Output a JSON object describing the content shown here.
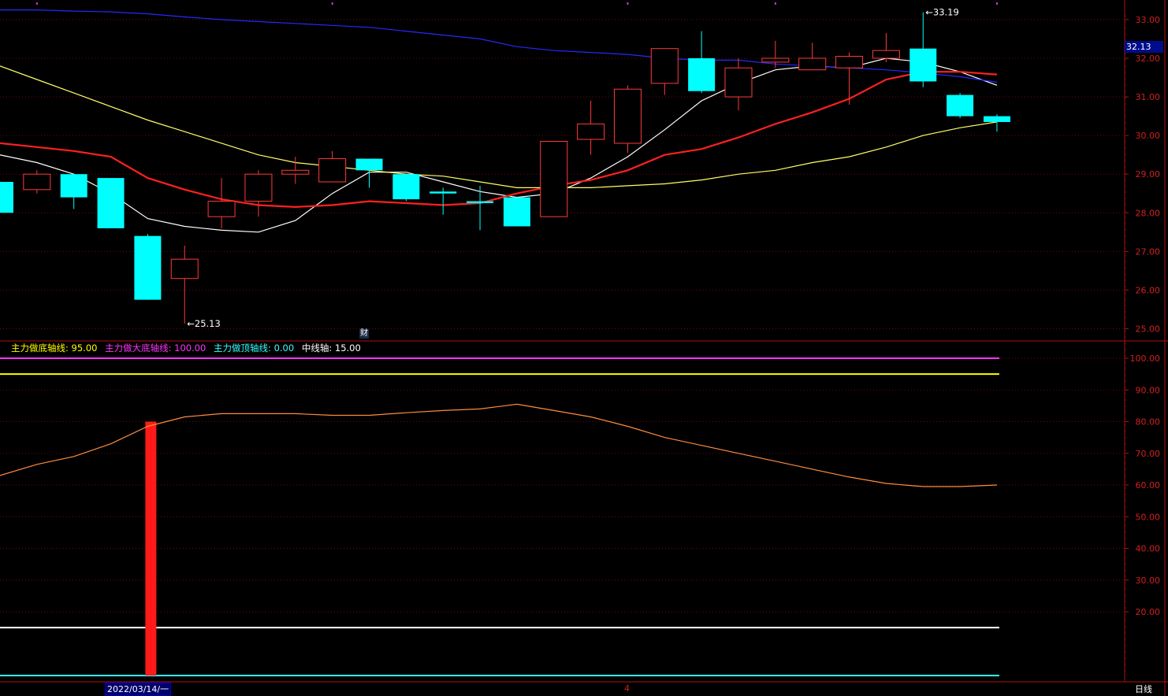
{
  "chart_data": [
    {
      "type": "candlestick",
      "title": "",
      "ylim": [
        24.7,
        33.45
      ],
      "y_ticks": [
        "25.00",
        "26.00",
        "27.00",
        "28.00",
        "29.00",
        "30.00",
        "31.00",
        "32.00",
        "33.00"
      ],
      "last_price_label": "32.13",
      "last_price": 32.13,
      "candles": [
        {
          "o": 28.8,
          "h": 28.8,
          "l": 28.0,
          "c": 28.0
        },
        {
          "o": 28.6,
          "h": 29.1,
          "l": 28.5,
          "c": 29.0
        },
        {
          "o": 29.0,
          "h": 29.0,
          "l": 28.1,
          "c": 28.4
        },
        {
          "o": 28.9,
          "h": 28.9,
          "l": 27.6,
          "c": 27.6
        },
        {
          "o": 27.4,
          "h": 27.45,
          "l": 25.75,
          "c": 25.75
        },
        {
          "o": 26.3,
          "h": 27.15,
          "l": 25.13,
          "c": 26.8
        },
        {
          "o": 27.9,
          "h": 28.9,
          "l": 27.6,
          "c": 28.3
        },
        {
          "o": 28.3,
          "h": 29.1,
          "l": 27.9,
          "c": 29.0
        },
        {
          "o": 29.0,
          "h": 29.45,
          "l": 28.75,
          "c": 29.1
        },
        {
          "o": 28.8,
          "h": 29.6,
          "l": 28.8,
          "c": 29.4
        },
        {
          "o": 29.4,
          "h": 29.4,
          "l": 28.65,
          "c": 29.1
        },
        {
          "o": 29.0,
          "h": 29.0,
          "l": 28.3,
          "c": 28.35
        },
        {
          "o": 28.55,
          "h": 28.65,
          "l": 27.95,
          "c": 28.5
        },
        {
          "o": 28.3,
          "h": 28.7,
          "l": 27.55,
          "c": 28.25
        },
        {
          "o": 28.4,
          "h": 28.4,
          "l": 27.65,
          "c": 27.65
        },
        {
          "o": 27.9,
          "h": 29.85,
          "l": 27.9,
          "c": 29.85
        },
        {
          "o": 29.9,
          "h": 30.9,
          "l": 29.5,
          "c": 30.3
        },
        {
          "o": 29.8,
          "h": 31.3,
          "l": 29.55,
          "c": 31.2
        },
        {
          "o": 31.35,
          "h": 32.25,
          "l": 31.05,
          "c": 32.25
        },
        {
          "o": 32.0,
          "h": 32.7,
          "l": 31.1,
          "c": 31.15
        },
        {
          "o": 31.0,
          "h": 32.0,
          "l": 30.65,
          "c": 31.75
        },
        {
          "o": 31.9,
          "h": 32.45,
          "l": 31.75,
          "c": 32.0
        },
        {
          "o": 31.7,
          "h": 32.4,
          "l": 31.7,
          "c": 32.0
        },
        {
          "o": 31.75,
          "h": 32.15,
          "l": 30.8,
          "c": 32.05
        },
        {
          "o": 32.0,
          "h": 32.65,
          "l": 31.9,
          "c": 32.2
        },
        {
          "o": 32.25,
          "h": 33.19,
          "l": 31.25,
          "c": 31.4
        },
        {
          "o": 31.05,
          "h": 31.1,
          "l": 30.45,
          "c": 30.5
        },
        {
          "o": 30.5,
          "h": 30.55,
          "l": 30.1,
          "c": 30.35
        }
      ],
      "ma_lines": [
        {
          "color": "#ffffff",
          "values": [
            29.5,
            29.3,
            29.0,
            28.5,
            27.85,
            27.65,
            27.55,
            27.5,
            27.8,
            28.5,
            29.05,
            29.05,
            28.8,
            28.55,
            28.4,
            28.5,
            28.9,
            29.45,
            30.15,
            30.9,
            31.35,
            31.7,
            31.8,
            31.75,
            32.0,
            31.9,
            31.65,
            31.3
          ]
        },
        {
          "color": "#ff2020",
          "values": [
            29.8,
            29.7,
            29.6,
            29.45,
            28.9,
            28.6,
            28.35,
            28.2,
            28.15,
            28.2,
            28.3,
            28.25,
            28.2,
            28.25,
            28.5,
            28.7,
            28.85,
            29.1,
            29.5,
            29.65,
            29.95,
            30.3,
            30.6,
            30.95,
            31.45,
            31.65,
            31.65,
            31.58
          ]
        },
        {
          "color": "#ffff66",
          "values": [
            31.8,
            31.45,
            31.1,
            30.75,
            30.4,
            30.1,
            29.8,
            29.5,
            29.3,
            29.2,
            29.1,
            29.0,
            28.95,
            28.8,
            28.65,
            28.65,
            28.65,
            28.7,
            28.75,
            28.85,
            29.0,
            29.1,
            29.3,
            29.45,
            29.7,
            30.0,
            30.2,
            30.35
          ]
        },
        {
          "color": "#2828ff",
          "values": [
            33.25,
            33.25,
            33.22,
            33.2,
            33.15,
            33.07,
            33.0,
            32.95,
            32.9,
            32.85,
            32.8,
            32.7,
            32.6,
            32.5,
            32.3,
            32.2,
            32.15,
            32.1,
            32.0,
            31.95,
            31.95,
            31.85,
            31.8,
            31.75,
            31.7,
            31.62,
            31.52,
            31.38
          ]
        }
      ],
      "annotations": [
        {
          "text": "33.19",
          "candle": 25,
          "price": 33.19
        },
        {
          "text": "25.13",
          "candle": 5,
          "price": 25.13
        }
      ],
      "top_marks": [
        1,
        9,
        17,
        21,
        27
      ]
    },
    {
      "type": "line",
      "title": "",
      "ylim": [
        0,
        105
      ],
      "y_ticks": [
        "20.00",
        "30.00",
        "40.00",
        "50.00",
        "60.00",
        "70.00",
        "80.00",
        "90.00",
        "100.00"
      ],
      "legend": [
        {
          "label": "主力做底轴线: 95.00",
          "color": "#ffff00",
          "value": 95
        },
        {
          "label": "主力做大底轴线: 100.00",
          "color": "#ff33ff",
          "value": 100
        },
        {
          "label": "主力做顶轴线: 0.00",
          "color": "#33ffff",
          "value": 0
        },
        {
          "label": "中线轴: 15.00",
          "color": "#ffffff",
          "value": 15
        }
      ],
      "oscillator": {
        "color": "#ff8c3c",
        "values": [
          63,
          66.5,
          69,
          73,
          78.5,
          81.5,
          82.5,
          82.5,
          82.5,
          82,
          82,
          82.8,
          83.5,
          84,
          85.5,
          83.5,
          81.5,
          78.5,
          75,
          72.5,
          70,
          67.5,
          65,
          62.5,
          60.5,
          59.5,
          59.5,
          60
        ]
      },
      "signal_bars": [
        {
          "candle": 4,
          "value": 80,
          "color": "#ff1a1a"
        }
      ]
    }
  ],
  "bottom_bar": {
    "date_label": "2022/03/14/一",
    "month_tick": "4",
    "period": "日线"
  },
  "badge": "财"
}
